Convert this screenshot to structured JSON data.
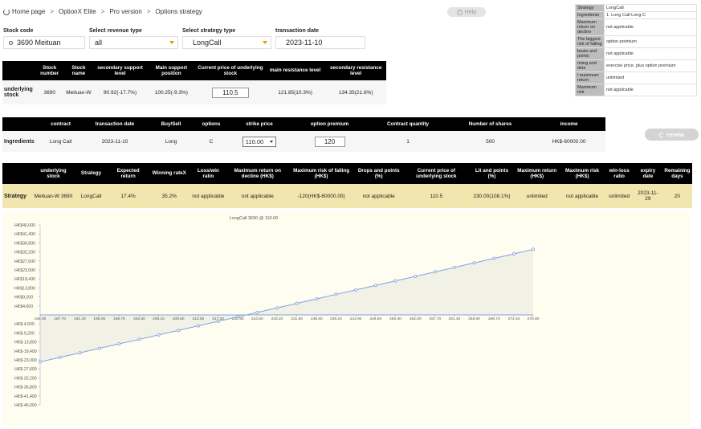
{
  "breadcrumb": {
    "items": [
      "Home page",
      "OptionX Elite",
      "Pro version",
      "Options strategy"
    ],
    "sep": ">"
  },
  "help": {
    "label": "Help",
    "icon": "help-icon"
  },
  "info_panel": [
    {
      "k": "Strategy",
      "v": "LongCall"
    },
    {
      "k": "Ingredients",
      "v": "1. Long Call-Long-C"
    },
    {
      "k": "Maximum return on decline",
      "v": "not applicable"
    },
    {
      "k": "The biggest risk of falling",
      "v": "option premium"
    },
    {
      "k": "beats and points",
      "v": "not applicable"
    },
    {
      "k": "rising and dots",
      "v": "exercise price, plus option premium"
    },
    {
      "k": "l maximum return",
      "v": "unlimited"
    },
    {
      "k": "Maximum risk",
      "v": "not applicable"
    }
  ],
  "form": {
    "stock_code_label": "Stock code",
    "stock_code_value": "3690 Meituan",
    "revenue_label": "Select revenue type",
    "revenue_value": "all",
    "strategy_label": "Select strategy type",
    "strategy_value": "LongCall",
    "date_label": "transaction date",
    "date_value": "2023-11-10"
  },
  "underlying": {
    "headers": [
      "Stock number",
      "Stock name",
      "secondary support level",
      "Main support position",
      "Current price of underlying stock",
      "main resistance level",
      "secondary resistance level"
    ],
    "row_label": "underlying stock",
    "values": {
      "stock_number": "3690",
      "stock_name": "Meituan-W",
      "secondary_support": "90.92(-17.7%)",
      "main_support": "100.25(-9.3%)",
      "current_price": "110.5",
      "main_resistance": "121.85(10.3%)",
      "secondary_resistance": "134.35(21.6%)"
    }
  },
  "ingredients": {
    "headers": [
      "contract",
      "transaction date",
      "Buy/Sell",
      "options",
      "strike price",
      "option premium",
      "Contract quantity",
      "Number of shares",
      "income"
    ],
    "row_label": "Ingredients",
    "values": {
      "contract": "Long Call",
      "date": "2023-11-10",
      "side": "Long",
      "option": "C",
      "strike": "110.00",
      "premium": "120",
      "qty": "1",
      "shares": "500",
      "income": "HK$-60000.00"
    }
  },
  "renew": {
    "label": "renew",
    "icon": "refresh-icon"
  },
  "strategy": {
    "headers": [
      "underlying stock",
      "Strategy",
      "Expected return",
      "Winning rateX",
      "Loss/win ratio",
      "Maximum return on decline (HK$)",
      "Maximum risk of falling (HK$)",
      "Drops and points (%)",
      "Current price of underlying stock",
      "Lit and points (%)",
      "Maximum return (HK$)",
      "Maximum risk (HK$)",
      "win-loss ratio",
      "expiry date",
      "Remaining days"
    ],
    "row_label": "Strategy",
    "values": [
      "Meituan-W 3690",
      "LongCall",
      "17.4%",
      "35.2%",
      "not applicable",
      "not applicable",
      "-120(HK$-60000.00)",
      "not applicable",
      "110.5",
      "230.00(108.1%)",
      "unlimited",
      "not applicable",
      "unlimited",
      "2023-11-29",
      "20"
    ]
  },
  "chart_data": {
    "type": "line",
    "title": "LongCall 3690 @ 110.00",
    "x": [
      184.0,
      187.7,
      191.4,
      195.05,
      198.75,
      202.5,
      206.1,
      209.8,
      213.5,
      217.2,
      220.9,
      224.5,
      228.2,
      231.9,
      235.6,
      239.2,
      242.9,
      246.6,
      250.3,
      254.0,
      257.7,
      261.3,
      265.0,
      268.7,
      272.4,
      276.0
    ],
    "y": [
      -24000,
      -21700,
      -19400,
      -17100,
      -14800,
      -12500,
      -10200,
      -7900,
      -5600,
      -3300,
      -1000,
      1300,
      3600,
      5900,
      8200,
      10500,
      12800,
      15100,
      17400,
      19700,
      22000,
      24300,
      26600,
      28900,
      31200,
      33500
    ],
    "x_tick_labels": [
      "184.00",
      "187.70",
      "191.40",
      "195.05",
      "198.75",
      "202.50",
      "206.10",
      "209.80",
      "213.50",
      "217.20",
      "220.90",
      "224.50",
      "228.20",
      "231.90",
      "235.60",
      "239.20",
      "242.90",
      "246.60",
      "250.30",
      "254.00",
      "257.70",
      "261.30",
      "265.00",
      "268.70",
      "272.40",
      "276.00"
    ],
    "y_ticks": [
      46000,
      41400,
      36800,
      32200,
      27600,
      23000,
      18400,
      13800,
      9200,
      4600,
      -4600,
      -9200,
      -13800,
      -18400,
      -23000,
      -27600,
      -32200,
      -36800,
      -41400,
      -46000
    ],
    "y_tick_labels": [
      "HK$46,000",
      "HK$41,400",
      "HK$36,800",
      "HK$32,200",
      "HK$27,600",
      "HK$23,000",
      "HK$18,400",
      "HK$13,800",
      "HK$9,200",
      "HK$4,600",
      "HK$-4,600",
      "HK$-9,200",
      "HK$-13,800",
      "HK$-18,400",
      "HK$-23,000",
      "HK$-27,600",
      "HK$-32,200",
      "HK$-36,800",
      "HK$-41,400",
      "HK$-46,000"
    ],
    "ylim": [
      -46000,
      46000
    ],
    "line_color": "#7fa3e0",
    "fill_color": "#f1f1e6",
    "bg_color": "#fffdf0"
  }
}
